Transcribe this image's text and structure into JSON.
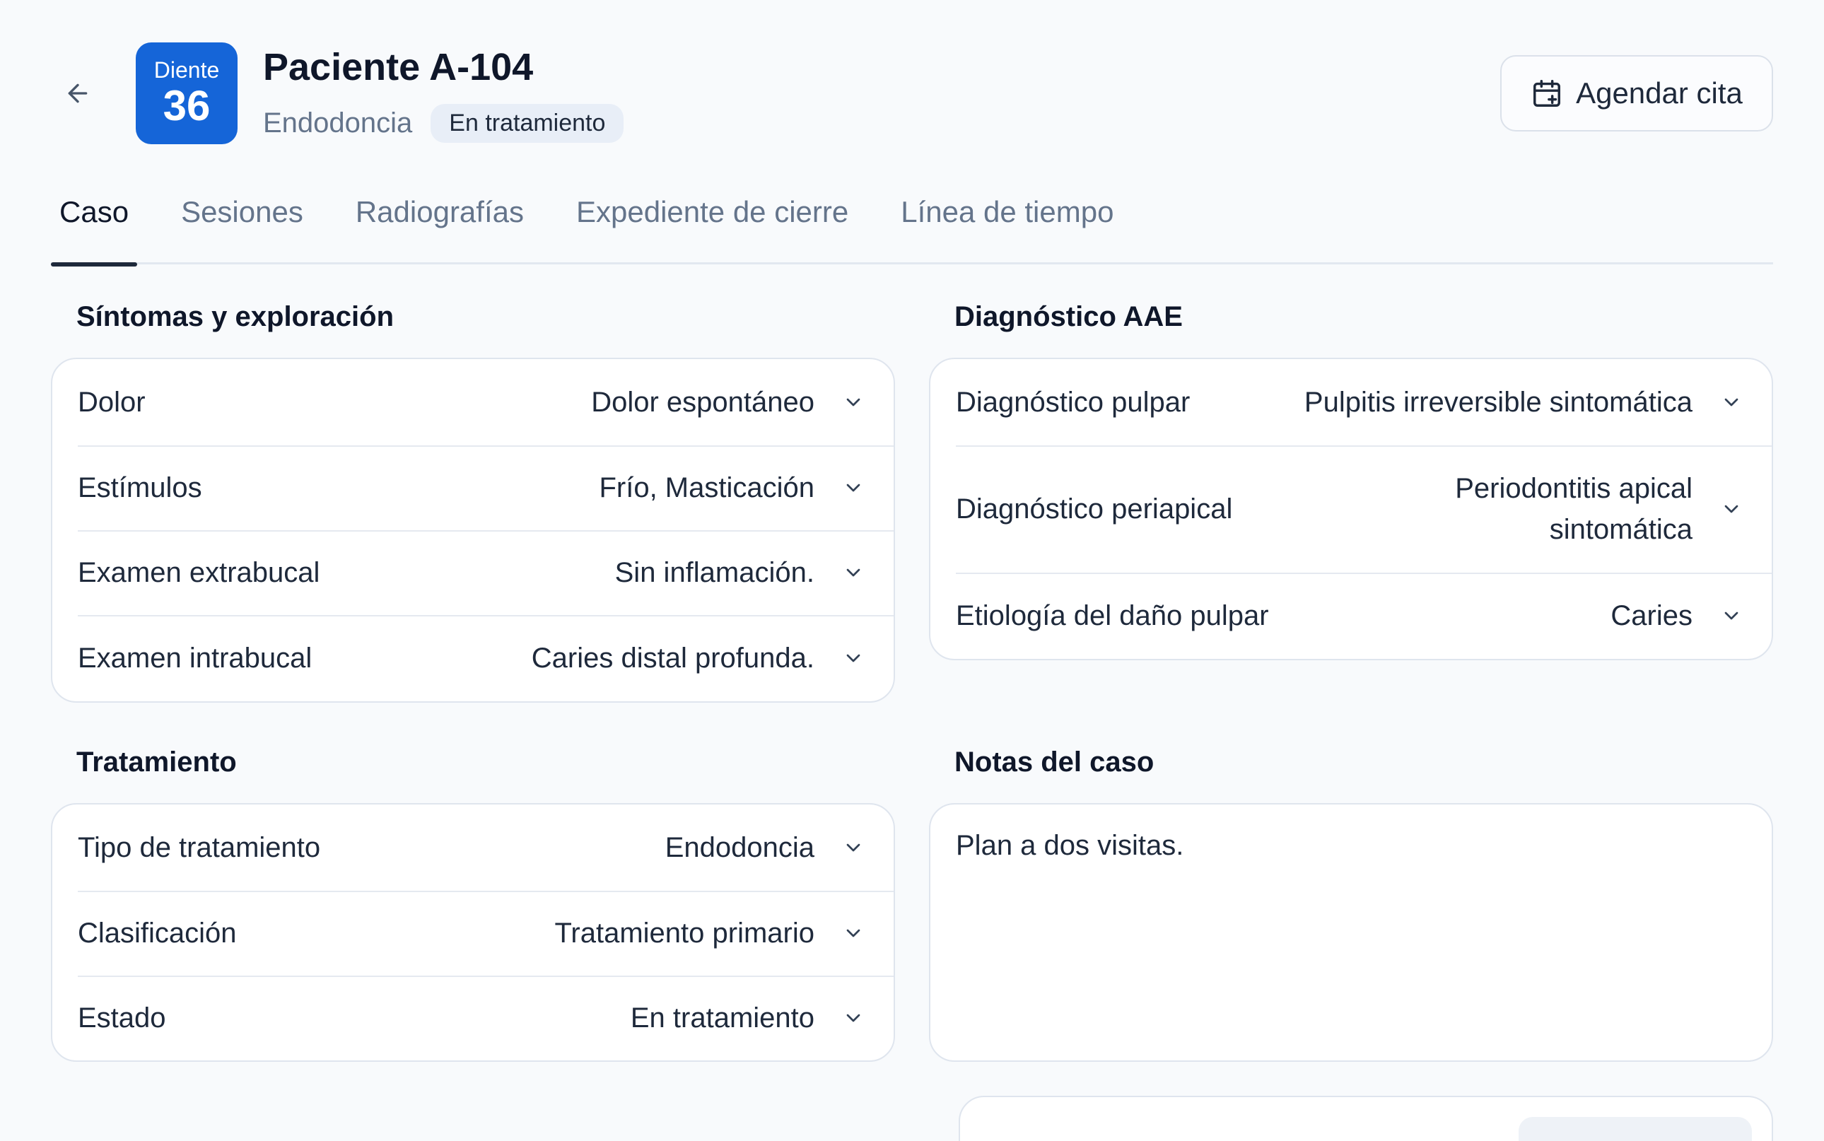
{
  "header": {
    "tooth_label": "Diente",
    "tooth_number": "36",
    "patient_title": "Paciente A-104",
    "specialty": "Endodoncia",
    "status": "En tratamiento",
    "schedule_button": "Agendar cita"
  },
  "tabs": [
    {
      "label": "Caso",
      "active": true
    },
    {
      "label": "Sesiones",
      "active": false
    },
    {
      "label": "Radiografías",
      "active": false
    },
    {
      "label": "Expediente de cierre",
      "active": false
    },
    {
      "label": "Línea de tiempo",
      "active": false
    }
  ],
  "symptoms": {
    "title": "Síntomas y exploración",
    "rows": [
      {
        "label": "Dolor",
        "value": "Dolor espontáneo"
      },
      {
        "label": "Estímulos",
        "value": "Frío, Masticación"
      },
      {
        "label": "Examen extrabucal",
        "value": "Sin inflamación."
      },
      {
        "label": "Examen intrabucal",
        "value": "Caries distal profunda."
      }
    ]
  },
  "diagnosis": {
    "title": "Diagnóstico AAE",
    "rows": [
      {
        "label": "Diagnóstico pulpar",
        "value": "Pulpitis irreversible sintomática"
      },
      {
        "label": "Diagnóstico periapical",
        "value_line1": "Periodontitis apical",
        "value_line2": "sintomática"
      },
      {
        "label": "Etiología del daño pulpar",
        "value": "Caries"
      }
    ]
  },
  "treatment": {
    "title": "Tratamiento",
    "rows": [
      {
        "label": "Tipo de tratamiento",
        "value": "Endodoncia"
      },
      {
        "label": "Clasificación",
        "value": "Tratamiento primario"
      },
      {
        "label": "Estado",
        "value": "En tratamiento"
      }
    ]
  },
  "notes": {
    "title": "Notas del caso",
    "text": "Plan a dos visitas."
  },
  "colors": {
    "accent": "#1565d8",
    "background": "#f8fafc",
    "text": "#1e293b",
    "muted": "#64748b"
  }
}
